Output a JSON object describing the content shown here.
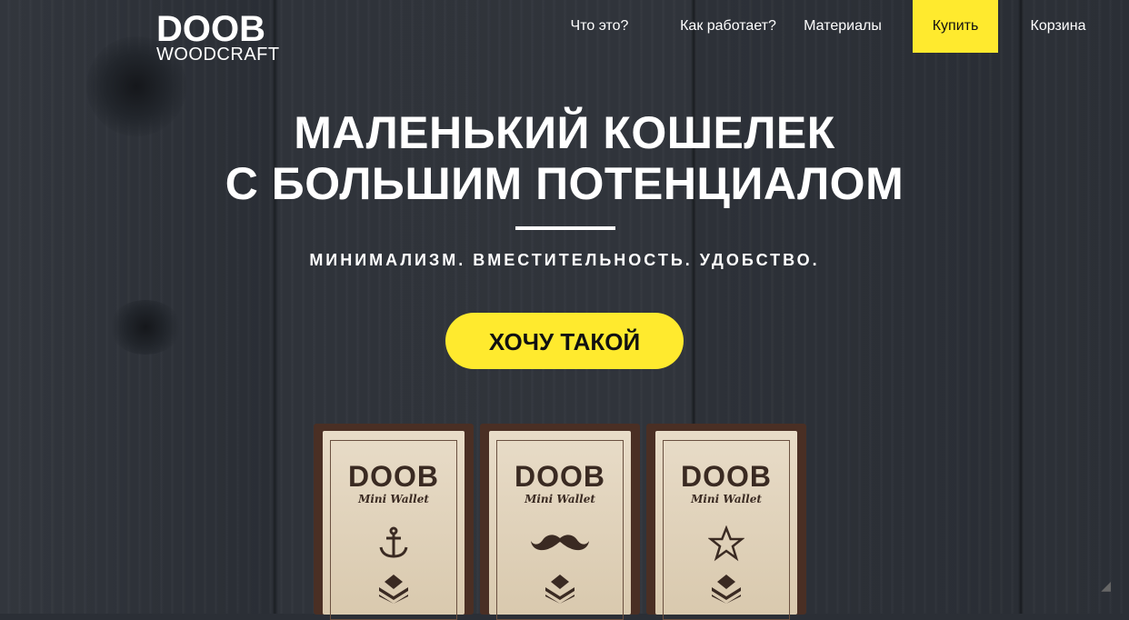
{
  "logo": {
    "line1": "DOOB",
    "line2": "WOODCRAFT"
  },
  "nav": {
    "items": [
      {
        "label": "Что это?"
      },
      {
        "label": "Как работает?"
      },
      {
        "label": "Материалы"
      },
      {
        "label": "Купить"
      },
      {
        "label": "Корзина"
      }
    ]
  },
  "hero": {
    "title_line1": "МАЛЕНЬКИЙ КОШЕЛЕК",
    "title_line2": "С БОЛЬШИМ ПОТЕНЦИАЛОМ",
    "tagline": "МИНИМАЛИЗМ. ВМЕСТИТЕЛЬНОСТЬ. УДОБСТВО.",
    "cta_label": "ХОЧУ ТАКОЙ"
  },
  "wallets": [
    {
      "brand": "DOOB",
      "sub": "Mini Wallet",
      "emblem": "anchor-icon"
    },
    {
      "brand": "DOOB",
      "sub": "Mini Wallet",
      "emblem": "mustache-icon"
    },
    {
      "brand": "DOOB",
      "sub": "Mini Wallet",
      "emblem": "star-icon"
    }
  ],
  "colors": {
    "accent": "#ffea2e",
    "background": "#2b2f36",
    "text": "#ffffff"
  }
}
